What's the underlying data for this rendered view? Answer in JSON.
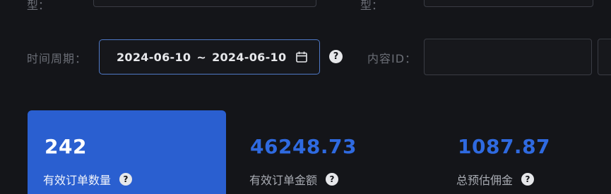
{
  "top_row": {
    "left_label_fragment": "型：",
    "right_label_fragment": "型："
  },
  "filters": {
    "period_label": "时间周期：",
    "date_start": "2024-06-10",
    "date_separator": "~",
    "date_end": "2024-06-10",
    "content_id_label": "内容ID：",
    "content_id_value": ""
  },
  "icons": {
    "help": "question-circle-icon",
    "help_glyph": "?",
    "calendar": "calendar-icon"
  },
  "stats": [
    {
      "value": "242",
      "label": "有效订单数量"
    },
    {
      "value": "46248.73",
      "label": "有效订单金额"
    },
    {
      "value": "1087.87",
      "label": "总预估佣金"
    }
  ],
  "colors": {
    "background": "#141519",
    "accent_blue": "#2a5fd0",
    "value_blue": "#2f6ae0",
    "focus_border": "#4f79c6"
  }
}
